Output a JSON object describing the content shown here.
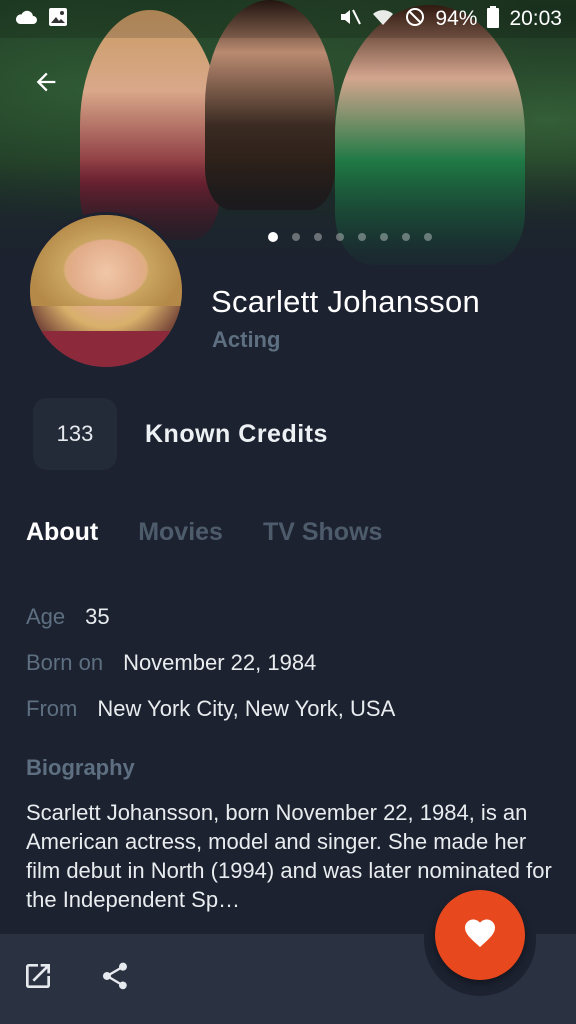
{
  "status_bar": {
    "battery": "94%",
    "time": "20:03"
  },
  "person": {
    "name": "Scarlett Johansson",
    "department": "Acting"
  },
  "carousel": {
    "count": 8,
    "active_index": 0
  },
  "credits": {
    "count": "133",
    "label": "Known Credits"
  },
  "tabs": [
    {
      "label": "About",
      "active": true
    },
    {
      "label": "Movies",
      "active": false
    },
    {
      "label": "TV Shows",
      "active": false
    }
  ],
  "info": {
    "age_label": "Age",
    "age_value": "35",
    "born_label": "Born on",
    "born_value": "November 22, 1984",
    "from_label": "From",
    "from_value": "New York City, New York, USA"
  },
  "biography": {
    "label": "Biography",
    "text": "Scarlett Johansson, born November 22, 1984, is an American actress, model and singer. She made her film debut in North (1994) and was later nominated for the Independent Sp…"
  },
  "colors": {
    "background": "#1c2230",
    "accent": "#e8481e",
    "muted_text": "#5d6f80",
    "bottom_bar": "#2a3140"
  },
  "icons": {
    "back": "arrow-left-icon",
    "open_external": "open-external-icon",
    "share": "share-icon",
    "favorite": "heart-icon"
  }
}
